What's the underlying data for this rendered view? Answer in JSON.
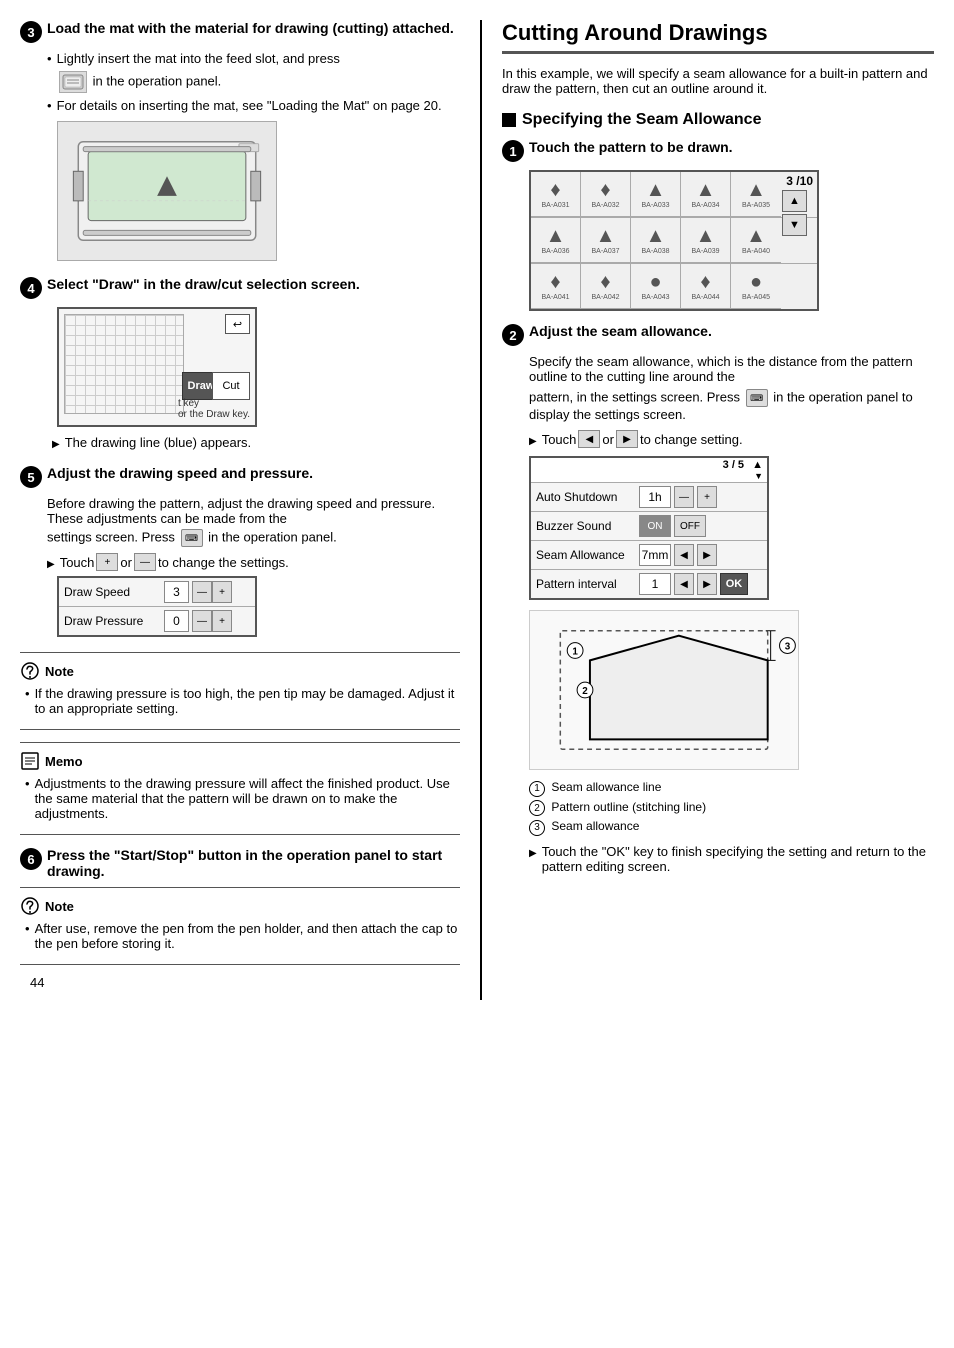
{
  "page": {
    "number": "44",
    "left_col": {
      "steps": {
        "step3": {
          "header": "Load the mat with the material for drawing (cutting) attached.",
          "bullets": [
            "Lightly insert the mat into the feed slot, and press",
            "in the operation panel.",
            "For details on inserting the mat, see \"Loading the Mat\" on page 20."
          ]
        },
        "step4": {
          "header": "Select \"Draw\" in the draw/cut selection screen.",
          "sub_note": "The drawing line (blue) appears."
        },
        "step5": {
          "header": "Adjust the drawing speed and pressure.",
          "desc": "Before drawing the pattern, adjust the drawing speed and pressure. These adjustments can be made from the",
          "desc2": "settings screen. Press",
          "desc3": "in the operation panel.",
          "touch_label": "Touch",
          "touch_mid": "or",
          "touch_end": "to change the settings.",
          "speed_panel": {
            "rows": [
              {
                "label": "Draw Speed",
                "value": "3"
              },
              {
                "label": "Draw Pressure",
                "value": "0"
              }
            ]
          }
        },
        "note1": {
          "title": "Note",
          "text": "If the drawing pressure is too high, the pen tip may be damaged. Adjust it to an appropriate setting."
        },
        "memo": {
          "title": "Memo",
          "text": "Adjustments to the drawing pressure will affect the finished product. Use the same material that the pattern will be drawn on to make the adjustments."
        },
        "step6": {
          "header": "Press the \"Start/Stop\" button in the operation panel to start drawing."
        },
        "note2": {
          "title": "Note",
          "text": "After use, remove the pen from the pen holder, and then attach the cap to the pen before storing it."
        }
      }
    },
    "right_col": {
      "title": "Cutting Around Drawings",
      "intro": "In this example, we will specify a seam allowance for a built-in pattern and draw the pattern, then cut an outline around it.",
      "subsection": "Specifying the Seam Allowance",
      "step1": {
        "header": "Touch the pattern to be drawn.",
        "pattern_page": "3 /10",
        "patterns": [
          {
            "id": "BA-A031",
            "shape": "♦"
          },
          {
            "id": "BA-A032",
            "shape": "♦"
          },
          {
            "id": "BA-A033",
            "shape": "▲"
          },
          {
            "id": "BA-A034",
            "shape": "▲"
          },
          {
            "id": "BA-A035",
            "shape": "▲"
          },
          {
            "id": "BA-A036",
            "shape": "▲"
          },
          {
            "id": "BA-A037",
            "shape": "▲"
          },
          {
            "id": "BA-A038",
            "shape": "▲"
          },
          {
            "id": "BA-A039",
            "shape": "▲"
          },
          {
            "id": "BA-A040",
            "shape": "▲"
          },
          {
            "id": "BA-A041",
            "shape": "♦"
          },
          {
            "id": "BA-A042",
            "shape": "♦"
          },
          {
            "id": "BA-A043",
            "shape": "●"
          },
          {
            "id": "BA-A044",
            "shape": "♦"
          },
          {
            "id": "BA-A045",
            "shape": "●"
          }
        ]
      },
      "step2": {
        "header": "Adjust the seam allowance.",
        "desc1": "Specify the seam allowance, which is the distance from the pattern outline to the cutting line around the",
        "desc2": "pattern, in the settings screen. Press",
        "desc3": "in the",
        "desc4": "operation panel to display the settings screen.",
        "touch_label": "Touch",
        "touch_mid": "or",
        "touch_end": "to change setting.",
        "settings_page": "3 / 5",
        "settings_rows": [
          {
            "label": "Auto Shutdown",
            "value": "1h",
            "ctrl": "+-"
          },
          {
            "label": "Buzzer Sound",
            "type": "onoff",
            "on_active": true
          },
          {
            "label": "Seam Allowance",
            "value": "7mm",
            "ctrl": "arrow"
          },
          {
            "label": "Pattern interval",
            "value": "1",
            "ctrl": "arrow",
            "ok": true
          }
        ],
        "legend": [
          "Seam allowance line",
          "Pattern outline (stitching line)",
          "Seam allowance"
        ],
        "final_note": "Touch the \"OK\" key to finish specifying the setting and return to the pattern editing screen."
      }
    }
  }
}
